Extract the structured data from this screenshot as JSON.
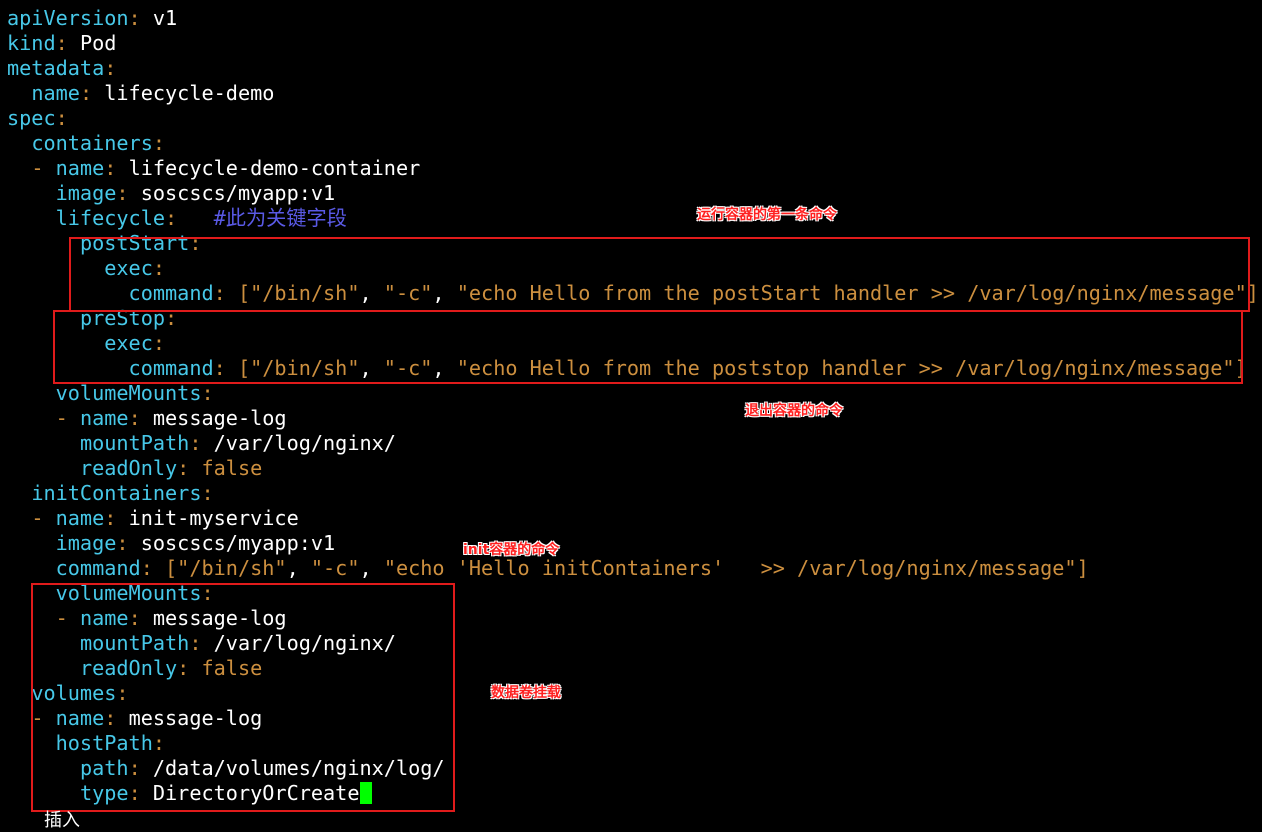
{
  "lines": [
    {
      "indent": "",
      "dash": "",
      "key": "apiVersion",
      "value": "v1"
    },
    {
      "indent": "",
      "dash": "",
      "key": "kind",
      "value": "Pod"
    },
    {
      "indent": "",
      "dash": "",
      "key": "metadata",
      "value": ""
    },
    {
      "indent": "  ",
      "dash": "",
      "key": "name",
      "value": "lifecycle-demo"
    },
    {
      "indent": "",
      "dash": "",
      "key": "spec",
      "value": ""
    },
    {
      "indent": "  ",
      "dash": "",
      "key": "containers",
      "value": ""
    },
    {
      "indent": "  ",
      "dash": "- ",
      "key": "name",
      "value": "lifecycle-demo-container"
    },
    {
      "indent": "    ",
      "dash": "",
      "key": "image",
      "value": "soscscs/myapp:v1"
    },
    {
      "indent": "    ",
      "dash": "",
      "key": "lifecycle",
      "value": "",
      "comment": "#此为关键字段"
    },
    {
      "indent": "      ",
      "dash": "",
      "key": "postStart",
      "value": ""
    },
    {
      "indent": "        ",
      "dash": "",
      "key": "exec",
      "value": ""
    },
    {
      "indent": "          ",
      "dash": "",
      "key": "command",
      "array": [
        "/bin/sh",
        "-c",
        "echo Hello from the postStart handler >> /var/log/nginx/message"
      ]
    },
    {
      "indent": "      ",
      "dash": "",
      "key": "preStop",
      "value": ""
    },
    {
      "indent": "        ",
      "dash": "",
      "key": "exec",
      "value": ""
    },
    {
      "indent": "          ",
      "dash": "",
      "key": "command",
      "array": [
        "/bin/sh",
        "-c",
        "echo Hello from the poststop handler >> /var/log/nginx/message"
      ]
    },
    {
      "indent": "    ",
      "dash": "",
      "key": "volumeMounts",
      "value": ""
    },
    {
      "indent": "    ",
      "dash": "- ",
      "key": "name",
      "value": "message-log"
    },
    {
      "indent": "      ",
      "dash": "",
      "key": "mountPath",
      "value": "/var/log/nginx/"
    },
    {
      "indent": "      ",
      "dash": "",
      "key": "readOnly",
      "bool": "false"
    },
    {
      "indent": "  ",
      "dash": "",
      "key": "initContainers",
      "value": ""
    },
    {
      "indent": "  ",
      "dash": "- ",
      "key": "name",
      "value": "init-myservice"
    },
    {
      "indent": "    ",
      "dash": "",
      "key": "image",
      "value": "soscscs/myapp:v1"
    },
    {
      "indent": "    ",
      "dash": "",
      "key": "command",
      "array": [
        "/bin/sh",
        "-c",
        "echo 'Hello initContainers'   >> /var/log/nginx/message"
      ]
    },
    {
      "indent": "    ",
      "dash": "",
      "key": "volumeMounts",
      "value": ""
    },
    {
      "indent": "    ",
      "dash": "- ",
      "key": "name",
      "value": "message-log"
    },
    {
      "indent": "      ",
      "dash": "",
      "key": "mountPath",
      "value": "/var/log/nginx/"
    },
    {
      "indent": "      ",
      "dash": "",
      "key": "readOnly",
      "bool": "false"
    },
    {
      "indent": "  ",
      "dash": "",
      "key": "volumes",
      "value": ""
    },
    {
      "indent": "  ",
      "dash": "- ",
      "key": "name",
      "value": "message-log"
    },
    {
      "indent": "    ",
      "dash": "",
      "key": "hostPath",
      "value": ""
    },
    {
      "indent": "      ",
      "dash": "",
      "key": "path",
      "value": "/data/volumes/nginx/log/"
    },
    {
      "indent": "      ",
      "dash": "",
      "key": "type",
      "value": "DirectoryOrCreate",
      "cursor": true
    }
  ],
  "annotations": {
    "poststart": "运行容器的第一条命令",
    "prestop": "退出容器的命令",
    "init": "init容器的命令",
    "volumes": "数据卷挂载"
  },
  "partial_bottom_text": "插入",
  "colors": {
    "background": "#000000",
    "key": "#47c8e8",
    "string": "#cc8f3f",
    "comment": "#5a5ae6",
    "cursor": "#00ff00",
    "annotation": "#ff2020",
    "box_border": "#e01b1b"
  }
}
